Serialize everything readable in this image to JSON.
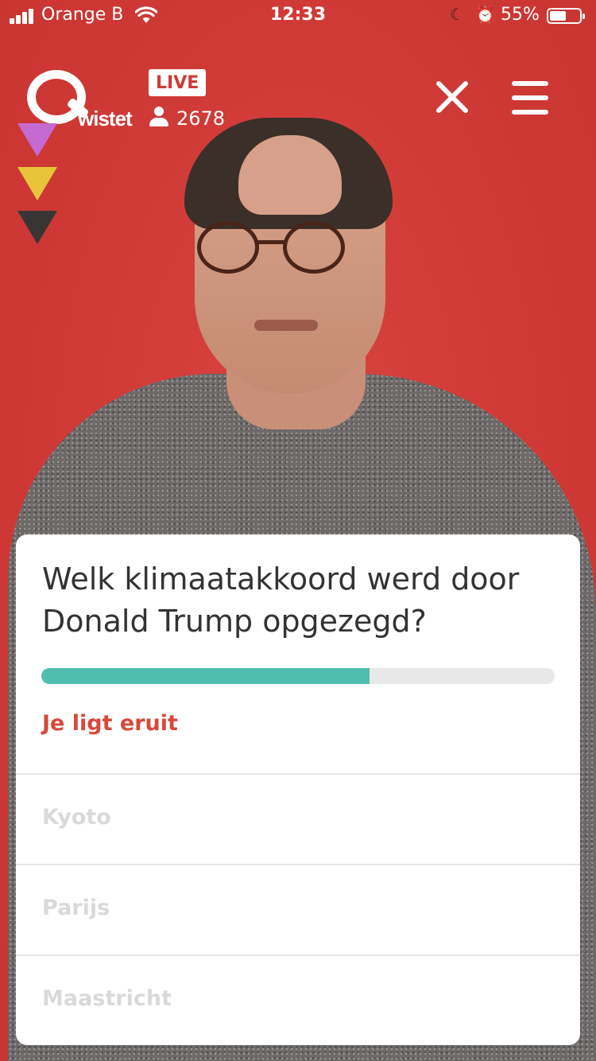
{
  "status_bar": {
    "carrier": "Orange B",
    "time": "12:33",
    "battery_percent": "55%",
    "battery_level": 0.55
  },
  "header": {
    "logo_text": "Qwistet",
    "live_label": "LIVE",
    "viewer_count": "2678"
  },
  "side_indicators": [
    {
      "color": "#c46ad2"
    },
    {
      "color": "#e7c43a"
    },
    {
      "color": "#3a3535"
    }
  ],
  "question_card": {
    "question": "Welk klimaatakkoord werd door Donald Trump opgezegd?",
    "progress": 0.64,
    "progress_color": "#4fbdaf",
    "status_message": "Je ligt eruit",
    "status_color": "#d9483b",
    "answers": [
      {
        "label": "Kyoto"
      },
      {
        "label": "Parijs"
      },
      {
        "label": "Maastricht"
      }
    ]
  },
  "colors": {
    "background": "#cf3a36",
    "answer_disabled_text": "#d9d9d9"
  }
}
